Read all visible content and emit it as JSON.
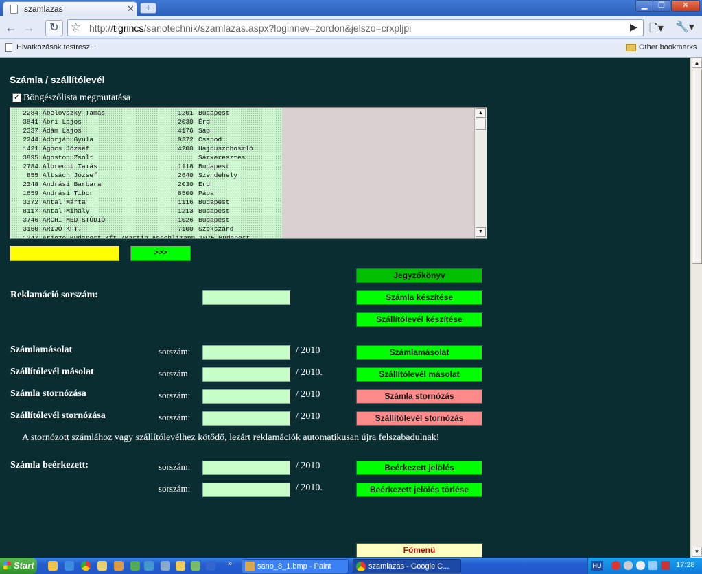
{
  "browser": {
    "tab_title": "szamlazas",
    "tab_close": "✕",
    "new_tab": "+",
    "url_prefix": "http://",
    "url_host": "tigrincs",
    "url_rest": "/sanotechnik/szamlazas.aspx?loginnev=zordon&jelszo=crxpljpi",
    "bookmark_label": "Hivatkozások testresz...",
    "other_bookmarks": "Other bookmarks"
  },
  "page": {
    "title": "Számla / szállítólevél",
    "browse_checkbox_label": "Böngészőlista megmutatása",
    "browse_checked": true,
    "list_rows": [
      {
        "id": "2284",
        "name": "Ábelovszky Tamás",
        "zip": "1201",
        "city": "Budapest"
      },
      {
        "id": "3841",
        "name": "Ábri Lajos",
        "zip": "2030",
        "city": "Érd"
      },
      {
        "id": "2337",
        "name": "Ádám Lajos",
        "zip": "4176",
        "city": "Sáp"
      },
      {
        "id": "2244",
        "name": "Adorján Gyula",
        "zip": "9372",
        "city": "Csapod"
      },
      {
        "id": "1421",
        "name": "Ágocs József",
        "zip": "4200",
        "city": "Hajduszoboszló"
      },
      {
        "id": "3895",
        "name": "Ágoston Zsolt",
        "zip": "",
        "city": "Sárkeresztes"
      },
      {
        "id": "2784",
        "name": "Albrecht Tamás",
        "zip": "1118",
        "city": "Budapest"
      },
      {
        "id": "855",
        "name": "Altsách József",
        "zip": "2640",
        "city": "Szendehely"
      },
      {
        "id": "2348",
        "name": "Andrási Barbara",
        "zip": "2030",
        "city": "Érd"
      },
      {
        "id": "1659",
        "name": "Andrási Tibor",
        "zip": "8500",
        "city": "Pápa"
      },
      {
        "id": "3372",
        "name": "Antal Márta",
        "zip": "1116",
        "city": "Budapest"
      },
      {
        "id": "8117",
        "name": "Antal Mihály",
        "zip": "1213",
        "city": "Budapest"
      },
      {
        "id": "3746",
        "name": "ARCHI MED STÚDIÓ",
        "zip": "1026",
        "city": "Budapest"
      },
      {
        "id": "3150",
        "name": "ARIJÓ KFT.",
        "zip": "7100",
        "city": "Szekszárd"
      },
      {
        "id": "1247",
        "name": "Arjozo Budapest Kft./Martin Aeschlimann 1075 Budapest",
        "zip": "",
        "city": ""
      }
    ],
    "search_value": "",
    "go_button": ">>>",
    "buttons": {
      "jegyzokonyv": "Jegyzőkönyv",
      "szamla_keszitese": "Számla készítése",
      "szallitolevel_keszitese": "Szállítólevél készítése",
      "szamlamasolat": "Számlamásolat",
      "szallitolevel_masolat": "Szállítólevél másolat",
      "szamla_stornozas": "Számla stornózás",
      "szallitolevel_stornozas": "Szállítólevél stornózás",
      "beerkezett_jeloles": "Beérkezett jelölés",
      "beerkezett_jeloles_torlese": "Beérkezett jelölés törlése",
      "fomenu": "Főmenü"
    },
    "labels": {
      "reklamacio": "Reklamáció sorszám:",
      "szamlamasolat": "Számlamásolat",
      "szallitolevel_masolat": "Szállítólevél másolat",
      "szamla_stornozasa": "Számla stornózása",
      "szallitolevel_stornozasa": "Szállítólevél stornózása",
      "szamla_beerkezett": "Számla beérkezett:",
      "sorszam_colon": "sorszám:",
      "sorszam": "sorszám",
      "year": "/ 2010",
      "year_dot": "/ 2010."
    },
    "notice": "A stornózott számlához vagy szállítólevélhez kötődő, lezárt reklamációk automatikusan újra felszabadulnak!"
  },
  "taskbar": {
    "start": "Start",
    "more": "»",
    "task_paint": "sano_8_1.bmp - Paint",
    "task_chrome": "szamlazas - Google C...",
    "lang": "HU",
    "clock": "17:28"
  }
}
